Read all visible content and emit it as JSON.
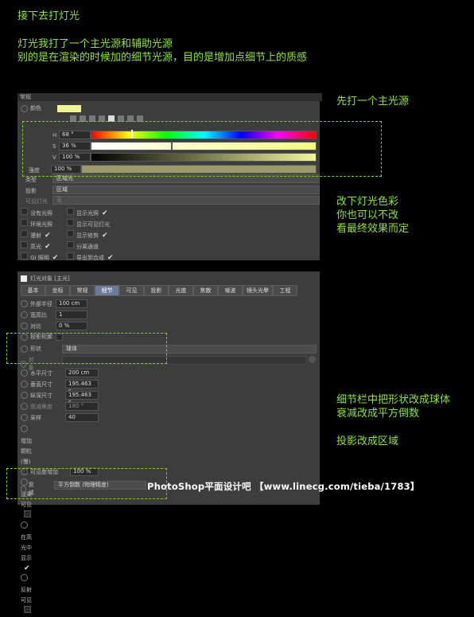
{
  "notes": {
    "title": "接下去打灯光",
    "line1": "灯光我打了一个主光源和辅助光源",
    "line2": "别的是在渲染的时候加的细节光源，目的是增加点细节上的质感",
    "main_light": "先打一个主光源",
    "color_1": "改下灯光色彩",
    "color_2": "你也可以不改",
    "color_3": "看最终效果而定",
    "detail_1": "细节栏中把形状改成球体",
    "detail_2": "衰减改成平方倒数",
    "projection": "投影改成区域"
  },
  "panel1": {
    "header": "常规",
    "color_label": "颜色",
    "h_label": "H",
    "h_value": "68 °",
    "s_label": "S",
    "s_value": "36 %",
    "v_label": "V",
    "v_value": "100 %",
    "intensity_label": "强度",
    "intensity_value": "100 %",
    "type_label": "类型",
    "type_value": "区域光",
    "shadow_label": "投影",
    "shadow_value": "区域",
    "visible_light_label": "可见灯光",
    "visible_light_value": "无",
    "left_options": [
      "没有光照",
      "环境光照",
      "漫射",
      "高光",
      "GI 照明"
    ],
    "right_options": [
      "显示光照",
      "显示可见灯光",
      "显示修剪",
      "分离通道",
      "导出到合成"
    ]
  },
  "panel2": {
    "title": "灯光对象 [主光]",
    "tabs": [
      "基本",
      "坐标",
      "常规",
      "细节",
      "可见",
      "投影",
      "光度",
      "焦散",
      "噪波",
      "镜头光晕",
      "工程"
    ],
    "outer_radius_label": "外部半径",
    "outer_radius_value": "100 cm",
    "aspect_label": "宽高比",
    "aspect_value": "1",
    "contrast_label": "对比",
    "contrast_value": "0 %",
    "projector_label": "投影轮廓",
    "shape_label": "形状",
    "shape_value": "球体",
    "object_label": "对象",
    "hsize_label": "水平尺寸",
    "hsize_value": "200 cm",
    "vsize_label": "垂直尺寸",
    "vsize_value": "195.463 c",
    "dsize_label": "纵深尺寸",
    "dsize_value": "195.463 c",
    "falloff_angle_label": "衰减角度",
    "falloff_angle_value": "180 °",
    "samples_label": "采样",
    "samples_value": "40",
    "extra": [
      "增加颗粒 (慢)",
      "渲染可见",
      "在高光中显示",
      "反射可见"
    ],
    "visibility_label": "可见度增加",
    "visibility_value": "100 %",
    "falloff_label": "衰减",
    "falloff_value": "平方倒数 (物理精度)"
  },
  "watermark": "PhotoShop平面设计吧 【www.linecg.com/tieba/1783】",
  "colors": {
    "note": "#8ee33a",
    "panel": "#3d3d3d",
    "swatch": "#f0f59a"
  }
}
